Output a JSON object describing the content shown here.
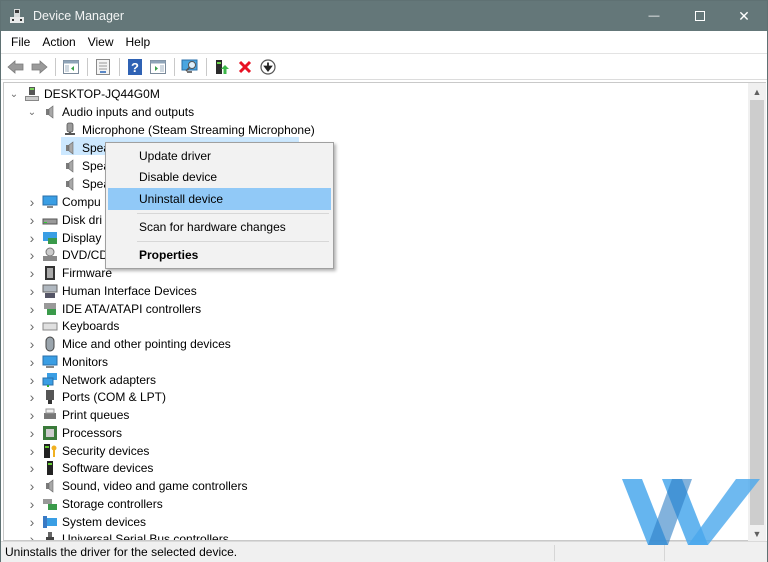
{
  "window": {
    "title": "Device Manager",
    "controls": {
      "minimize": "—",
      "maximize": "☐",
      "close": "✕"
    }
  },
  "menubar": {
    "items": [
      "File",
      "Action",
      "View",
      "Help"
    ]
  },
  "toolbar": {
    "buttons": [
      {
        "name": "back-icon"
      },
      {
        "name": "forward-icon"
      },
      {
        "name": "show-hide-console-tree-icon"
      },
      {
        "name": "properties-icon"
      },
      {
        "name": "help-icon"
      },
      {
        "name": "action-pane-icon"
      },
      {
        "name": "scan-hardware-icon"
      },
      {
        "name": "update-driver-icon"
      },
      {
        "name": "uninstall-device-icon"
      },
      {
        "name": "disable-device-icon"
      }
    ]
  },
  "tree": {
    "root": {
      "label": "DESKTOP-JQ44G0M",
      "expanded": true
    },
    "audio": {
      "label": "Audio inputs and outputs",
      "expanded": true
    },
    "audio_children": [
      {
        "label": "Microphone (Steam Streaming Microphone)"
      },
      {
        "label": "Spea",
        "selected": true
      },
      {
        "label": "Spea"
      },
      {
        "label": "Spea"
      }
    ],
    "categories": [
      {
        "label": "Compu",
        "icon": "computer-icon"
      },
      {
        "label": "Disk dri",
        "icon": "disk-drive-icon"
      },
      {
        "label": "Display",
        "icon": "display-adapter-icon"
      },
      {
        "label": "DVD/CD",
        "icon": "dvd-drive-icon"
      },
      {
        "label": "Firmware",
        "icon": "firmware-icon"
      },
      {
        "label": "Human Interface Devices",
        "icon": "hid-icon"
      },
      {
        "label": "IDE ATA/ATAPI controllers",
        "icon": "ide-controller-icon"
      },
      {
        "label": "Keyboards",
        "icon": "keyboard-icon"
      },
      {
        "label": "Mice and other pointing devices",
        "icon": "mouse-icon"
      },
      {
        "label": "Monitors",
        "icon": "monitor-icon"
      },
      {
        "label": "Network adapters",
        "icon": "network-adapter-icon"
      },
      {
        "label": "Ports (COM & LPT)",
        "icon": "port-icon"
      },
      {
        "label": "Print queues",
        "icon": "printer-icon"
      },
      {
        "label": "Processors",
        "icon": "processor-icon"
      },
      {
        "label": "Security devices",
        "icon": "security-device-icon"
      },
      {
        "label": "Software devices",
        "icon": "software-device-icon"
      },
      {
        "label": "Sound, video and game controllers",
        "icon": "speaker-icon"
      },
      {
        "label": "Storage controllers",
        "icon": "storage-controller-icon"
      },
      {
        "label": "System devices",
        "icon": "system-device-icon"
      },
      {
        "label": "Universal Serial Bus controllers",
        "icon": "usb-icon"
      }
    ]
  },
  "context_menu": {
    "items": [
      {
        "label": "Update driver"
      },
      {
        "label": "Disable device"
      },
      {
        "label": "Uninstall device",
        "highlighted": true
      },
      {
        "label": "Scan for hardware changes"
      },
      {
        "label": "Properties",
        "bold": true
      }
    ]
  },
  "statusbar": {
    "text": "Uninstalls the driver for the selected device."
  },
  "colors": {
    "titlebar": "#647779",
    "selection": "#cce8ff",
    "menu_highlight": "#91c9f7",
    "uninstall_red": "#e81123",
    "watermark_blue": "#4aa8ec"
  }
}
